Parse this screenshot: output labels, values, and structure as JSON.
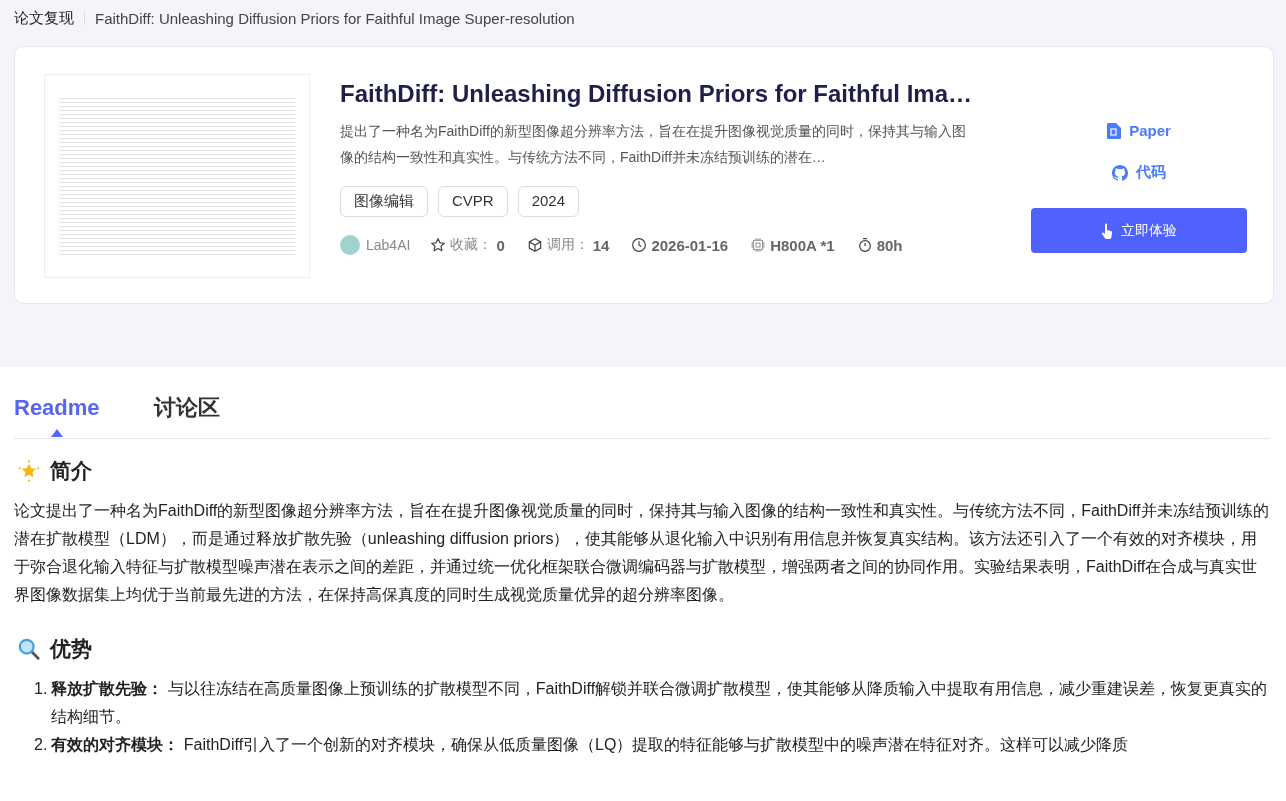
{
  "breadcrumb": {
    "section": "论文复现",
    "current": "FaithDiff: Unleashing Diffusion Priors for Faithful Image Super-resolution"
  },
  "paper": {
    "title": "FaithDiff: Unleashing Diffusion Priors for Faithful Ima…",
    "description": "提出了一种名为FaithDiff的新型图像超分辨率方法，旨在在提升图像视觉质量的同时，保持其与输入图像的结构一致性和真实性。与传统方法不同，FaithDiff并未冻结预训练的潜在…",
    "tags": [
      "图像编辑",
      "CVPR",
      "2024"
    ],
    "author": "Lab4AI",
    "stats": [
      {
        "kind": "favorites",
        "label": "收藏：",
        "value": "0"
      },
      {
        "kind": "calls",
        "label": "调用：",
        "value": "14"
      },
      {
        "kind": "date",
        "value": "2026-01-16"
      },
      {
        "kind": "gpu",
        "value": "H800A *1"
      },
      {
        "kind": "duration",
        "value": "80h"
      }
    ],
    "links": [
      {
        "kind": "paper",
        "label": "Paper"
      },
      {
        "kind": "code",
        "label": "代码"
      }
    ],
    "action": "立即体验"
  },
  "tabs": [
    {
      "label": "Readme",
      "selected": true
    },
    {
      "label": "讨论区",
      "selected": false
    }
  ],
  "sections": [
    {
      "kind": "intro",
      "heading": "简介",
      "paragraph": "论文提出了一种名为FaithDiff的新型图像超分辨率方法，旨在在提升图像视觉质量的同时，保持其与输入图像的结构一致性和真实性。与传统方法不同，FaithDiff并未冻结预训练的潜在扩散模型（LDM），而是通过释放扩散先验（unleashing diffusion priors），使其能够从退化输入中识别有用信息并恢复真实结构。该方法还引入了一个有效的对齐模块，用于弥合退化输入特征与扩散模型噪声潜在表示之间的差距，并通过统一优化框架联合微调编码器与扩散模型，增强两者之间的协同作用。实验结果表明，FaithDiff在合成与真实世界图像数据集上均优于当前最先进的方法，在保持高保真度的同时生成视觉质量优异的超分辨率图像。"
    },
    {
      "kind": "advantages",
      "heading": "优势",
      "items": [
        {
          "number": "1.",
          "text": "**释放扩散先验：** 与以往冻结在高质量图像上预训练的扩散模型不同，FaithDiff解锁并联合微调扩散模型，使其能够从降质输入中提取有用信息，减少重建误差，恢复更真实的结构细节。"
        },
        {
          "number": "2.",
          "text": "**有效的对齐模块：** FaithDiff引入了一个创新的对齐模块，确保从低质量图像（LQ）提取的特征能够与扩散模型中的噪声潜在特征对齐。这样可以减少降质"
        }
      ]
    }
  ]
}
